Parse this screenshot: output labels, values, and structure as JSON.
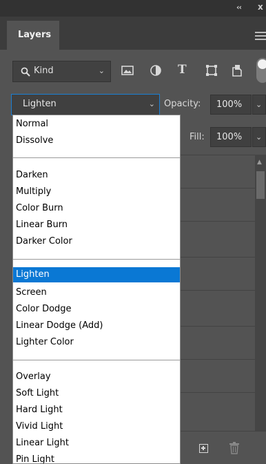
{
  "panel": {
    "tab_title": "Layers",
    "collapse_glyph": "‹‹",
    "close_glyph": "x"
  },
  "filter": {
    "kind_label": "Kind",
    "text_filter_glyph": "T"
  },
  "blend_mode": {
    "current": "Lighten",
    "opacity_label": "Opacity:",
    "opacity_value": "100%",
    "fill_label": "Fill:",
    "fill_value": "100%"
  },
  "dropdown": {
    "options": [
      "Normal",
      "Dissolve",
      "Darken",
      "Multiply",
      "Color Burn",
      "Linear Burn",
      "Darker Color",
      "Lighten",
      "Screen",
      "Color Dodge",
      "Linear Dodge (Add)",
      "Lighter Color",
      "Overlay",
      "Soft Light",
      "Hard Light",
      "Vivid Light",
      "Linear Light",
      "Pin Light"
    ],
    "selected": "Lighten"
  },
  "colors": {
    "panel_bg": "#535353",
    "selection": "#0a78d4",
    "focus_border": "#1a7fd4"
  }
}
